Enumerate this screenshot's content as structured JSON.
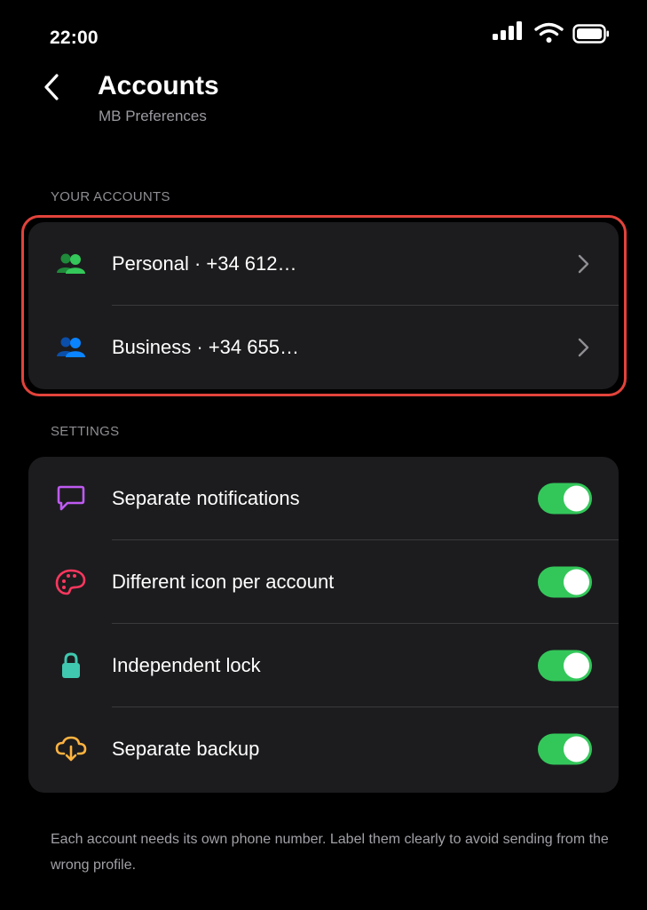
{
  "status_bar": {
    "time": "22:00"
  },
  "header": {
    "title": "Accounts",
    "subtitle": "MB Preferences"
  },
  "accounts_section": {
    "label": "YOUR ACCOUNTS",
    "items": [
      {
        "label": "Personal · +34 612…",
        "icon": "people-icon",
        "color": "#34c759"
      },
      {
        "label": "Business · +34 655…",
        "icon": "people-icon",
        "color": "#0a84ff"
      }
    ]
  },
  "settings_section": {
    "label": "SETTINGS",
    "items": [
      {
        "label": "Separate notifications",
        "icon": "message-bubble-icon",
        "color": "#bf5af2",
        "enabled": true
      },
      {
        "label": "Different icon per account",
        "icon": "palette-icon",
        "color": "#ff375f",
        "enabled": true
      },
      {
        "label": "Independent lock",
        "icon": "lock-icon",
        "color": "#40c8b0",
        "enabled": true
      },
      {
        "label": "Separate backup",
        "icon": "cloud-download-icon",
        "color": "#ffb340",
        "enabled": true
      }
    ]
  },
  "footer": {
    "note": "Each account needs its own phone number. Label them clearly to avoid sending from the wrong profile."
  },
  "colors": {
    "toggle_on": "#33c75a",
    "highlight": "#e2433b",
    "card": "#1c1c1e"
  }
}
